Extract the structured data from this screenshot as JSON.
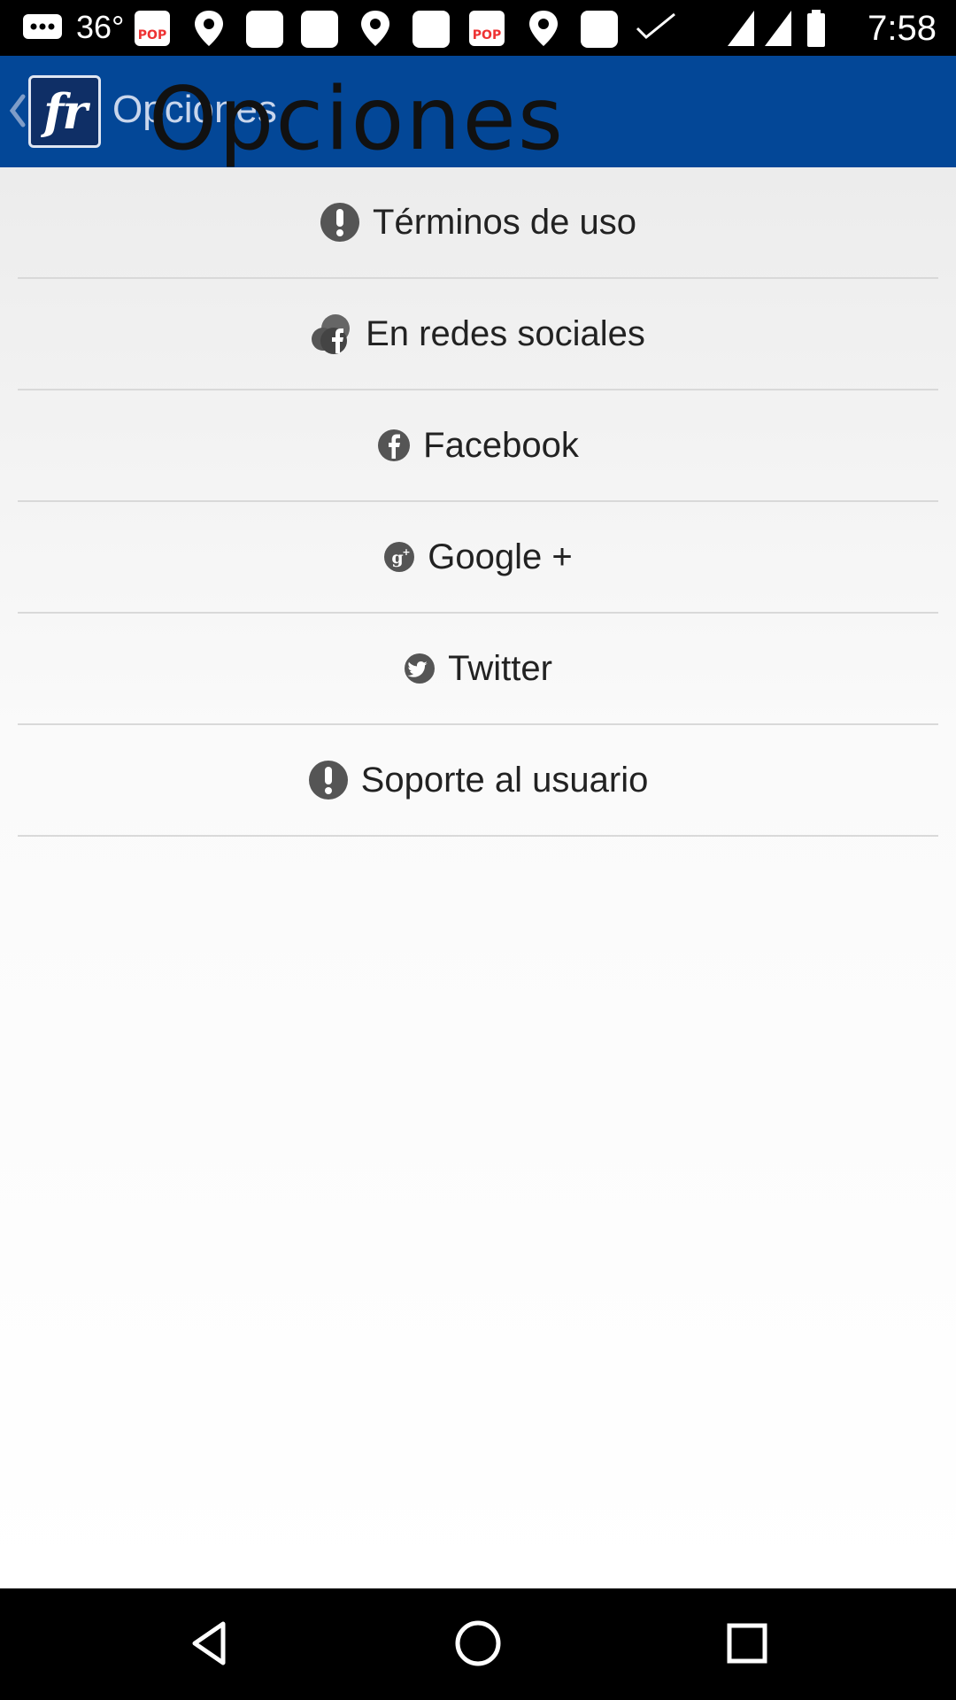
{
  "status_bar": {
    "temperature": "36°",
    "time": "7:58"
  },
  "app_bar": {
    "title": "Opciones",
    "logo_text": "fr",
    "overlay_title": "Opciones"
  },
  "menu": {
    "items": [
      {
        "label": "Términos de uso",
        "icon": "info-icon"
      },
      {
        "label": "En redes sociales",
        "icon": "social-icon"
      },
      {
        "label": "Facebook",
        "icon": "facebook-icon"
      },
      {
        "label": "Google +",
        "icon": "google-plus-icon"
      },
      {
        "label": "Twitter",
        "icon": "twitter-icon"
      },
      {
        "label": "Soporte al usuario",
        "icon": "info-icon"
      }
    ]
  },
  "colors": {
    "app_bar": "#034797",
    "status_bar": "#000000",
    "nav_bar": "#000000",
    "icon": "#555555"
  }
}
